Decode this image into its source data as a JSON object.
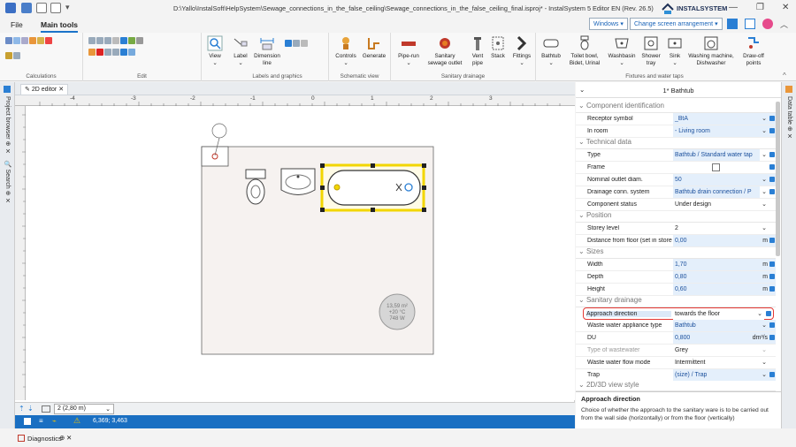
{
  "window": {
    "title": "D:\\Yallo\\InstalSoft\\HelpSystem\\Sewage_connections_in_the_false_ceiling\\Sewage_connections_in_the_false_ceiling_final.isproj* - InstalSystem 5 Editor EN (Rev. 26.5)",
    "brand": "INSTALSYSTEM"
  },
  "menu": {
    "file": "File",
    "main_tools": "Main tools"
  },
  "top_buttons": {
    "windows": "Windows",
    "screen": "Change screen arrangement"
  },
  "ribbon": {
    "groups": {
      "calculations": "Calculations",
      "edit": "Edit",
      "labels": "Labels and graphics",
      "schematic": "Schematic view",
      "drainage": "Sanitary drainage",
      "fixtures": "Fixtures and water taps"
    },
    "buttons": {
      "view": "View",
      "label": "Label",
      "dimension": "Dimension line",
      "controls": "Controls",
      "generate": "Generate",
      "pipe_run": "Pipe-run",
      "sewage_outlet": "Sanitary sewage outlet",
      "vent_pipe": "Vent pipe",
      "stack": "Stack",
      "fittings": "Fittings",
      "bathtub": "Bathtub",
      "toilet": "Toilet bowl, Bidet, Urinal",
      "washbasin": "Washbasin",
      "shower": "Shower tray",
      "sink": "Sink",
      "washing": "Washing machine, Dishwasher",
      "drawoff": "Draw-off points"
    }
  },
  "left_panel": {
    "project_browser": "Project browser",
    "search": "Search"
  },
  "editor": {
    "tab": "2D editor",
    "ruler_ticks": [
      "-4",
      "-3",
      "-2",
      "-1",
      "0",
      "1",
      "2",
      "3"
    ],
    "room_label": [
      "13,59 m²",
      "+20 °C",
      "748 W"
    ],
    "storey_select": "2 (2,80 m)",
    "coords": "6,369; 3,463"
  },
  "right_panel": {
    "data_table": "Data table"
  },
  "diagnostics": "Diagnostics",
  "properties": {
    "header": "1* Bathtub",
    "categories": {
      "component": "Component identification",
      "technical": "Technical data",
      "position": "Position",
      "sizes": "Sizes",
      "drainage": "Sanitary drainage",
      "view_style": "2D/3D view style"
    },
    "rows": {
      "receptor": {
        "label": "Receptor symbol",
        "value": "_BtA"
      },
      "room": {
        "label": "In room",
        "value": "- Living room"
      },
      "type": {
        "label": "Type",
        "value": "Bathtub / Standard water tap"
      },
      "frame": {
        "label": "Frame",
        "value": ""
      },
      "outlet": {
        "label": "Nominal outlet diam.",
        "value": "50"
      },
      "conn": {
        "label": "Drainage conn. system",
        "value": "Bathtub drain connection / P"
      },
      "status": {
        "label": "Component status",
        "value": "Under design"
      },
      "storey": {
        "label": "Storey level",
        "value": "2"
      },
      "distance": {
        "label": "Distance from floor (set in storey)",
        "value": "0,00",
        "unit": "m"
      },
      "width": {
        "label": "Width",
        "value": "1,70",
        "unit": "m"
      },
      "depth": {
        "label": "Depth",
        "value": "0,80",
        "unit": "m"
      },
      "height": {
        "label": "Height",
        "value": "0,60",
        "unit": "m"
      },
      "approach": {
        "label": "Approach direction",
        "value": "towards the floor"
      },
      "appliance": {
        "label": "Waste water appliance type",
        "value": "Bathtub"
      },
      "du": {
        "label": "DU",
        "value": "0,800",
        "unit": "dm³/s"
      },
      "wastewater": {
        "label": "Type of wastewater",
        "value": "Grey"
      },
      "flowmode": {
        "label": "Waste water flow mode",
        "value": "Intermittent"
      },
      "trap": {
        "label": "Trap",
        "value": "(size) / Trap"
      }
    },
    "description": {
      "title": "Approach direction",
      "text": "Choice of whether the approach to the sanitary ware is to be carried out from the wall side (horizontally) or from the floor (vertically)"
    }
  },
  "colors": {
    "accent": "#1a6fc2",
    "highlight": "#e53935",
    "selection": "#f2d600"
  }
}
